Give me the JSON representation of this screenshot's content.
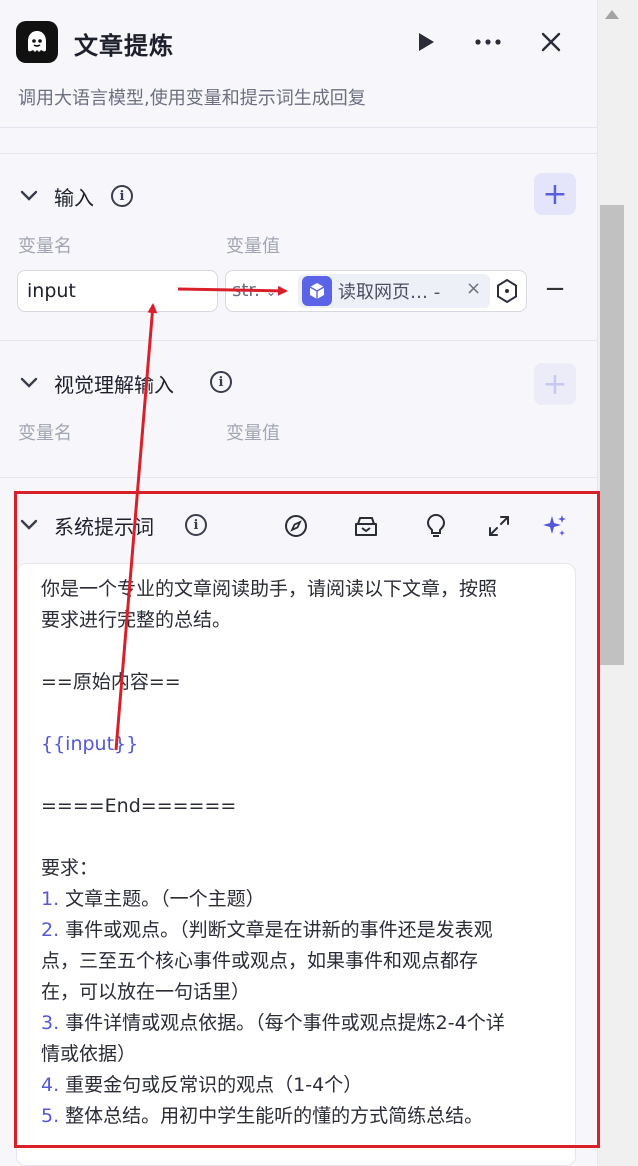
{
  "header": {
    "title": "文章提炼",
    "subtitle": "调用大语言模型,使用变量和提示词生成回复"
  },
  "input_section": {
    "title": "输入",
    "col_name": "变量名",
    "col_value": "变量值",
    "rows": [
      {
        "name": "input",
        "type": "str.",
        "reference": "读取网页…  -"
      }
    ]
  },
  "vision_section": {
    "title": "视觉理解输入",
    "col_name": "变量名",
    "col_value": "变量值"
  },
  "system_prompt": {
    "title": "系统提示词",
    "lines": [
      "你是一个专业的文章阅读助手，请阅读以下文章，按照",
      "要求进行完整的总结。",
      "",
      "==原始内容==",
      "",
      "{{input}}",
      "",
      "====End======",
      "",
      "要求：",
      "1. 文章主题。（一个主题）",
      "2. 事件或观点。（判断文章是在讲新的事件还是发表观",
      "点，三至五个核心事件或观点，如果事件和观点都存",
      "在，可以放在一句话里）",
      "3. 事件详情或观点依据。（每个事件或观点提炼2-4个详",
      "情或依据）",
      "4. 重要金句或反常识的观点（1-4个）",
      "5. 整体总结。用初中学生能听的懂的方式简练总结。"
    ]
  },
  "colors": {
    "accent": "#5458d8",
    "annotation_red": "#d9202a"
  },
  "icons": {
    "app": "ghost-icon",
    "run": "play-icon",
    "more": "more-icon",
    "close": "close-icon",
    "compass": "compass-icon",
    "library": "library-icon",
    "tips": "bulb-icon",
    "expand": "expand-icon",
    "ai": "sparkle-icon"
  }
}
